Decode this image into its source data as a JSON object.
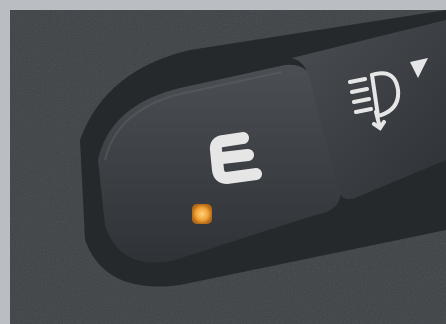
{
  "scene": {
    "description_icons": [
      "eco-mode-e-icon",
      "fog-light-icon"
    ],
    "indicator_color": "#f2a53a",
    "panel_color": "#3d4145",
    "button_color": "#3a3d41",
    "symbol_color": "#e6e6e6"
  }
}
